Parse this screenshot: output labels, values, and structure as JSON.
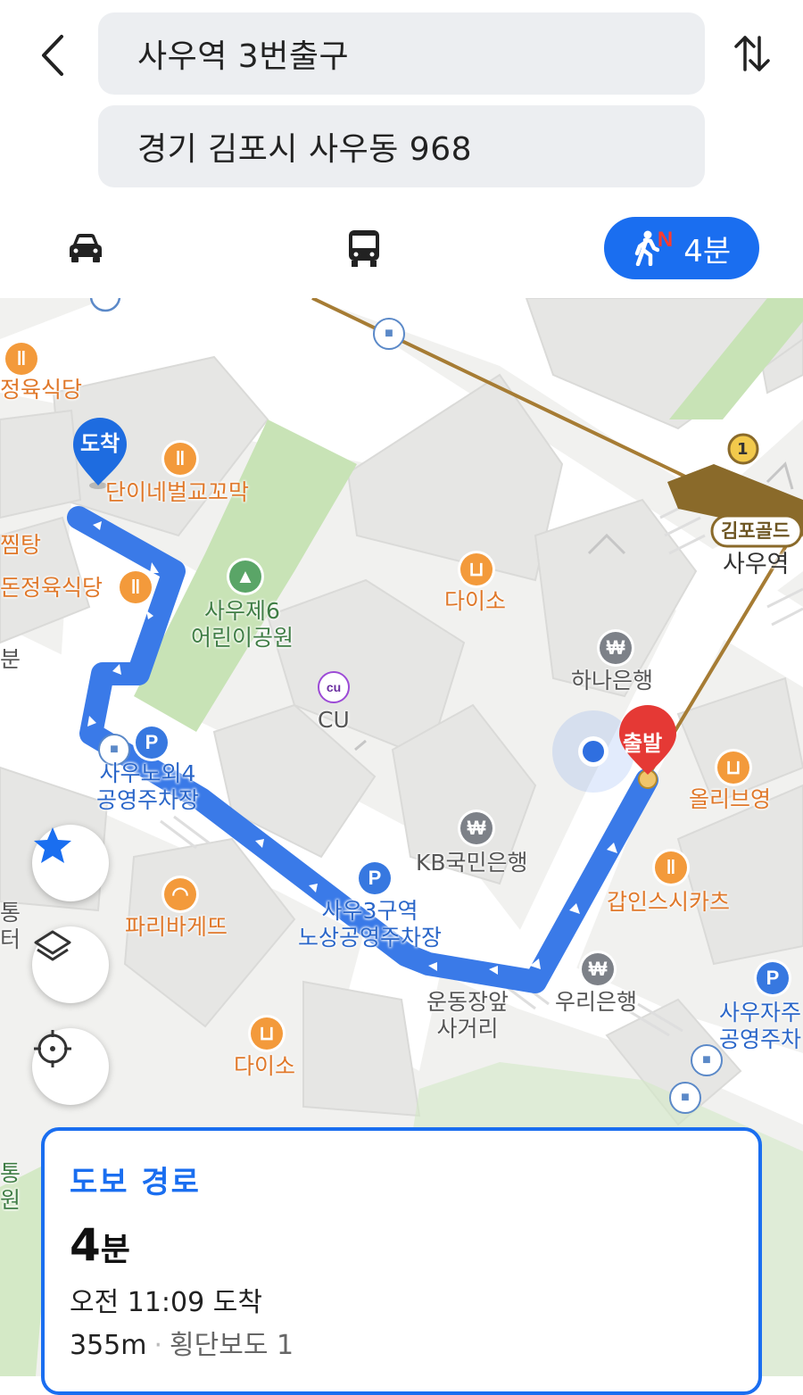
{
  "header": {
    "back_icon": "chevron-left-icon",
    "origin": "사우역 3번출구",
    "destination": "경기 김포시 사우동 968",
    "swap_icon": "swap-vertical-icon"
  },
  "modes": {
    "car_icon": "car-icon",
    "bus_icon": "bus-icon",
    "walk_icon": "walking-person-icon",
    "walk_badge": "N",
    "walk_time": "4분",
    "active_color": "#1a6ef0"
  },
  "map": {
    "start_marker": "출발",
    "end_marker": "도착",
    "route_color": "#3a7ae8",
    "pois": {
      "jeongyuk": "정육식당",
      "dani": "단이네벌교꼬막",
      "jjimtang": "찜탕",
      "dongjeong": "돈정육식당",
      "bun": "분",
      "park": "사우제6\n어린이공원",
      "daiso1": "다이소",
      "cu_name": "CU",
      "cu_badge": "cu",
      "hana": "하나은행",
      "gimpo_gold": "김포골드",
      "sau_station": "사우역",
      "line_badge": "1",
      "olive": "올리브영",
      "kb": "KB국민은행",
      "parking_sau4": "사우노외4\n공영주차장",
      "parking_p": "P",
      "gapin": "갑인스시카츠",
      "sau3": "사우3구역\n노상공영주차장",
      "paris": "파리바게뜨",
      "woori": "우리은행",
      "undong": "운동장앞\n사거리",
      "daiso2": "다이소",
      "sauja": "사우자주\n공영주차",
      "edge_tong": "통",
      "edge_teo": "터",
      "edge_tong2": "통",
      "edge_won": "원",
      "won_symbol": "₩"
    }
  },
  "controls": {
    "favorite_icon": "star-icon",
    "layers_icon": "layers-icon",
    "locate_icon": "crosshair-icon"
  },
  "route_card": {
    "title": "도보 경로",
    "duration_value": "4",
    "duration_unit": "분",
    "arrival": "오전 11:09 도착",
    "distance": "355m",
    "separator": "·",
    "crosswalk": "횡단보도 1"
  }
}
